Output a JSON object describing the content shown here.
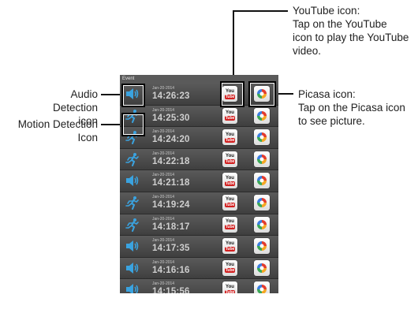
{
  "callouts": {
    "youtube": "YouTube icon:\nTap on the YouTube\nicon to play the YouTube\nvideo.",
    "picasa": "Picasa icon:\nTap on the Picasa icon\nto see picture.",
    "audio": "Audio\nDetection icon",
    "motion": "Motion Detection\nIcon"
  },
  "screen": {
    "header": "Event",
    "youtube_you": "You",
    "youtube_tube": "Tube",
    "rows": [
      {
        "type": "audio-icon",
        "date": "Jan-20-2014",
        "time": "14:26:23"
      },
      {
        "type": "motion-icon",
        "date": "Jan-20-2014",
        "time": "14:25:30"
      },
      {
        "type": "motion-icon",
        "date": "Jan-20-2014",
        "time": "14:24:20"
      },
      {
        "type": "motion-icon",
        "date": "Jan-20-2014",
        "time": "14:22:18"
      },
      {
        "type": "audio-icon",
        "date": "Jan-20-2014",
        "time": "14:21:18"
      },
      {
        "type": "motion-icon",
        "date": "Jan-20-2014",
        "time": "14:19:24"
      },
      {
        "type": "motion-icon",
        "date": "Jan-20-2014",
        "time": "14:18:17"
      },
      {
        "type": "audio-icon",
        "date": "Jan-20-2014",
        "time": "14:17:35"
      },
      {
        "type": "audio-icon",
        "date": "Jan-20-2014",
        "time": "14:16:16"
      },
      {
        "type": "audio-icon",
        "date": "Jan-20-2014",
        "time": "14:15:56"
      }
    ]
  },
  "colors": {
    "icon_blue": "#3aa3e0",
    "screen_bg": "#4a4a4a"
  }
}
